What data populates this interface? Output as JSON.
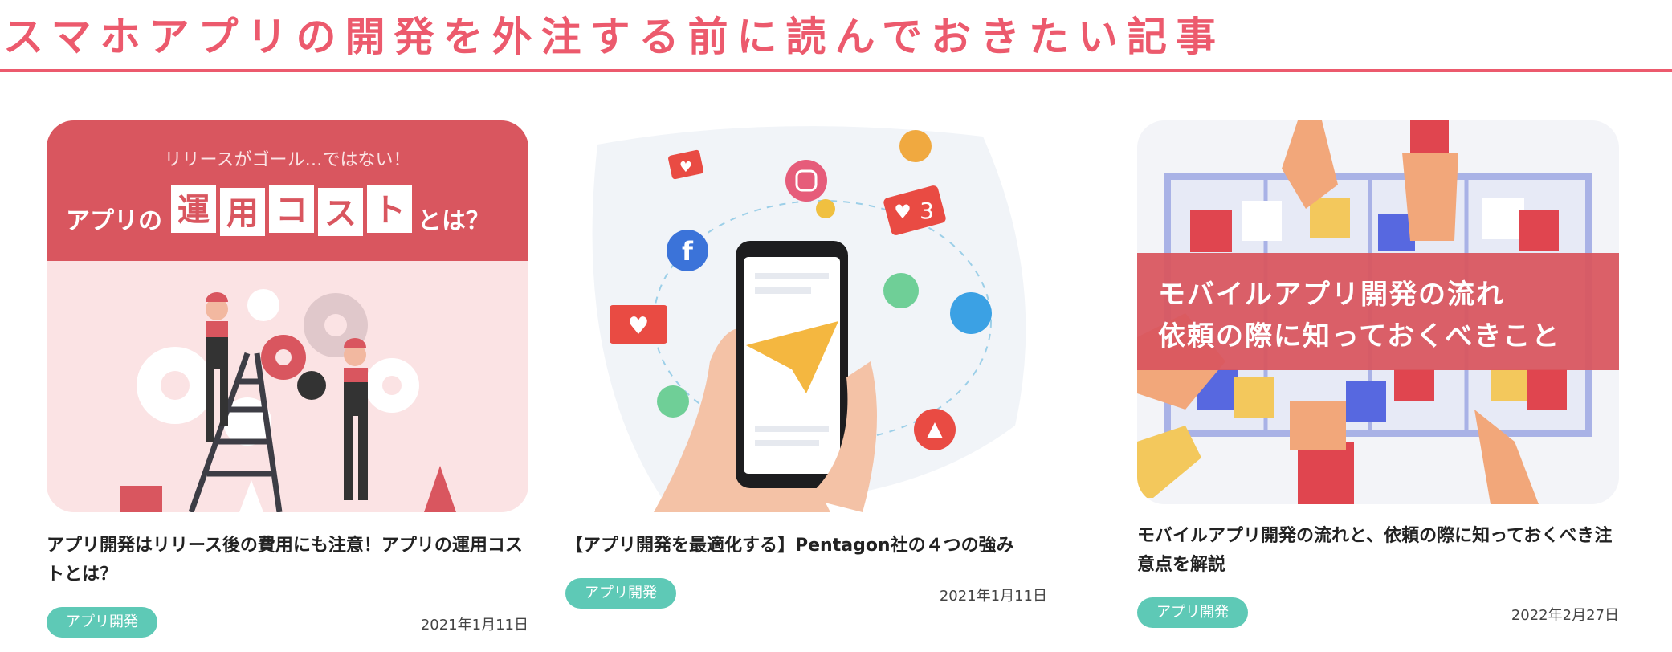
{
  "section": {
    "heading": "スマホアプリの開発を外注する前に読んでおきたい記事"
  },
  "articles": [
    {
      "thumb_top_text": "リリースがゴール…ではない！",
      "thumb_main_prefix": "アプリの",
      "thumb_main_boxes": [
        "運",
        "用",
        "コ",
        "ス",
        "ト"
      ],
      "thumb_main_suffix": "とは？",
      "title": "アプリ開発はリリース後の費用にも注意！アプリの運用コストとは？",
      "tag": "アプリ開発",
      "date": "2021年1月11日"
    },
    {
      "thumb_badge": "3",
      "title": "【アプリ開発を最適化する】Pentagon社の４つの強み",
      "tag": "アプリ開発",
      "date": "2021年1月11日"
    },
    {
      "thumb_line1": "モバイルアプリ開発の流れ",
      "thumb_line2": "依頼の際に知っておくべきこと",
      "title": "モバイルアプリ開発の流れと、依頼の際に知っておくべき注意点を解説",
      "tag": "アプリ開発",
      "date": "2022年2月27日"
    }
  ],
  "colors": {
    "accent": "#ec5a6d",
    "tag_bg": "#5ec9b6",
    "banner_red": "#d9565f",
    "banner_pink": "#fbe3e4"
  }
}
